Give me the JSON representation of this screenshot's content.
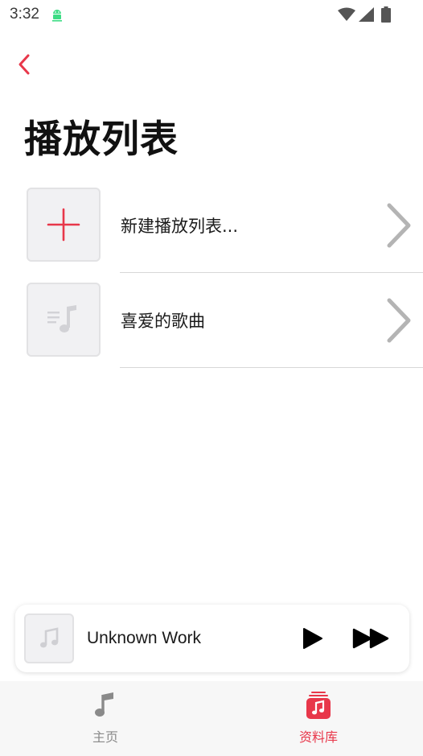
{
  "status_bar": {
    "time": "3:32"
  },
  "page": {
    "title": "播放列表"
  },
  "playlists": [
    {
      "label": "新建播放列表...",
      "icon": "plus-icon"
    },
    {
      "label": "喜爱的歌曲",
      "icon": "music-list-icon"
    }
  ],
  "mini_player": {
    "title": "Unknown Work"
  },
  "tabs": [
    {
      "label": "主页",
      "icon": "music-note-icon",
      "active": false
    },
    {
      "label": "资料库",
      "icon": "library-icon",
      "active": true
    }
  ],
  "colors": {
    "accent": "#e8374a",
    "chevron": "#b4b4b4",
    "placeholder_bg": "#f1f1f3",
    "tab_inactive": "#8a8a8a"
  }
}
